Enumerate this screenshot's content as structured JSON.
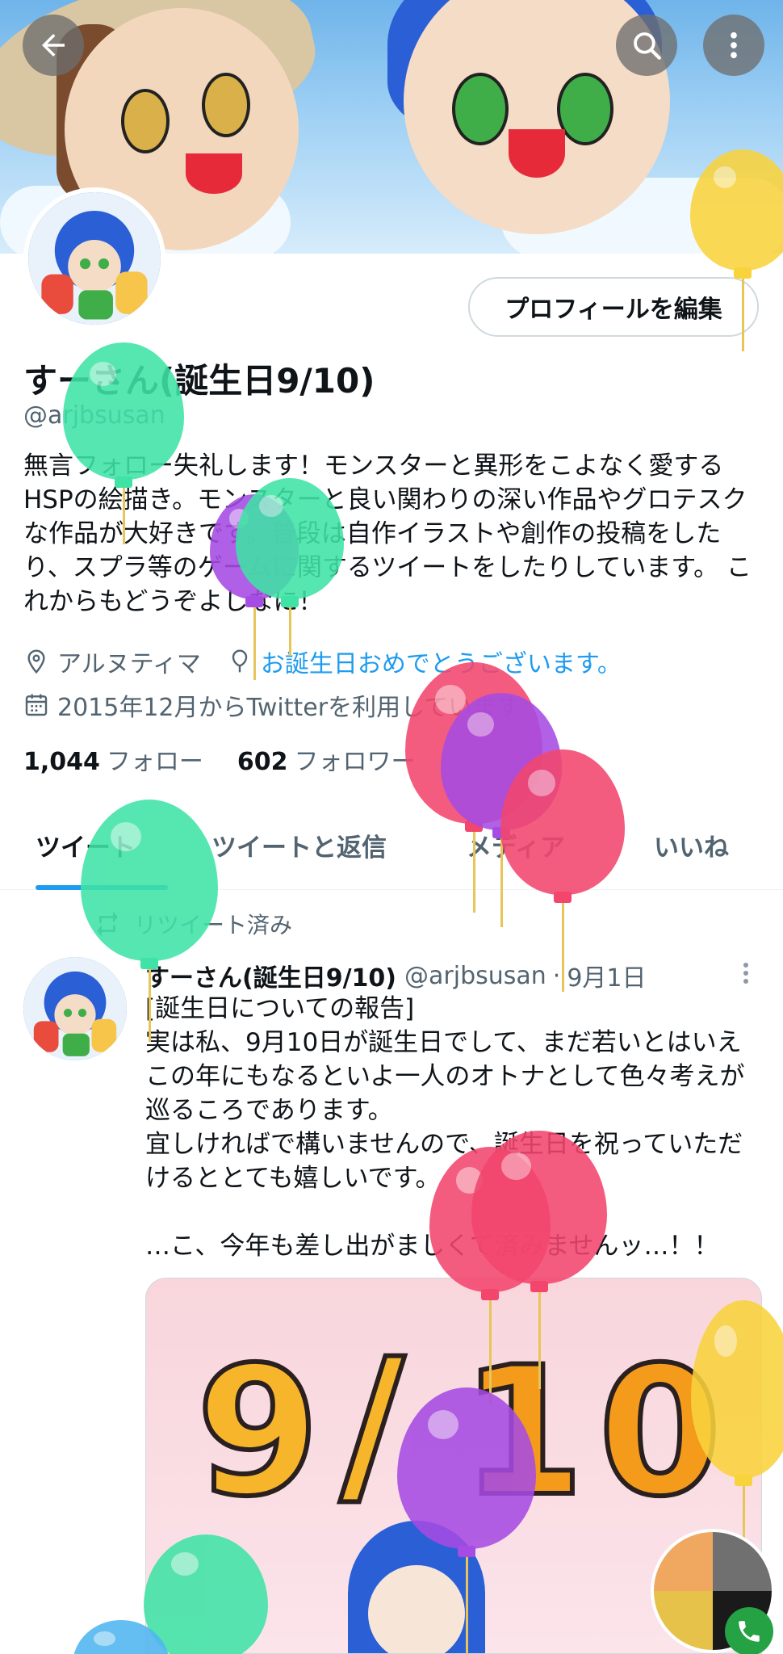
{
  "header": {
    "back_icon": "arrow-left-icon",
    "search_icon": "search-icon",
    "more_icon": "more-vertical-icon"
  },
  "profile": {
    "edit_button": "プロフィールを編集",
    "display_name": "すーさん(誕生日9/10)",
    "handle": "@arjbsusan",
    "bio": "無言フォロー失礼します！モンスターと異形をこよなく愛するHSPの絵描き。モンスターと良い関わりの深い作品やグロテスクな作品が大好きです。普段は自作イラストや創作の投稿をしたり、スプラ等のゲームに関するツイートをしたりしています。 これからもどうぞよしなに！",
    "location": "アルヌティマ",
    "birthday_text": "お誕生日おめでとうございます。",
    "joined": "2015年12月からTwitterを利用しています",
    "following_count": "1,044",
    "following_label": "フォロー",
    "followers_count": "602",
    "followers_label": "フォロワー"
  },
  "tabs": [
    {
      "label": "ツイート",
      "active": true
    },
    {
      "label": "ツイートと返信",
      "active": false
    },
    {
      "label": "メディア",
      "active": false
    },
    {
      "label": "いいね",
      "active": false
    }
  ],
  "tweet": {
    "retweet_label": "リツイート済み",
    "author_name": "すーさん(誕生日9/10)",
    "author_handle": "@arjbsusan",
    "separator": "·",
    "date": "9月1日",
    "text": "[誕生日についての報告]\n実は私、9月10日が誕生日でして、まだ若いとはいえこの年にもなるといよ一人のオトナとして色々考えが巡るころであります。\n宜しければで構いませんので、誕生日を祝っていただけるととても嬉しいです。\n\n…こ、今年も差し出がましくて済みませんッ…！！",
    "image_text": [
      "9",
      "/",
      "1",
      "0"
    ]
  },
  "colors": {
    "link": "#1d9bf0",
    "balloon_green": "#3fe3a6",
    "balloon_purple": "#a64be3",
    "balloon_pink": "#f2466d",
    "balloon_yellow": "#f9d33c",
    "balloon_blue": "#4fb6f0"
  }
}
